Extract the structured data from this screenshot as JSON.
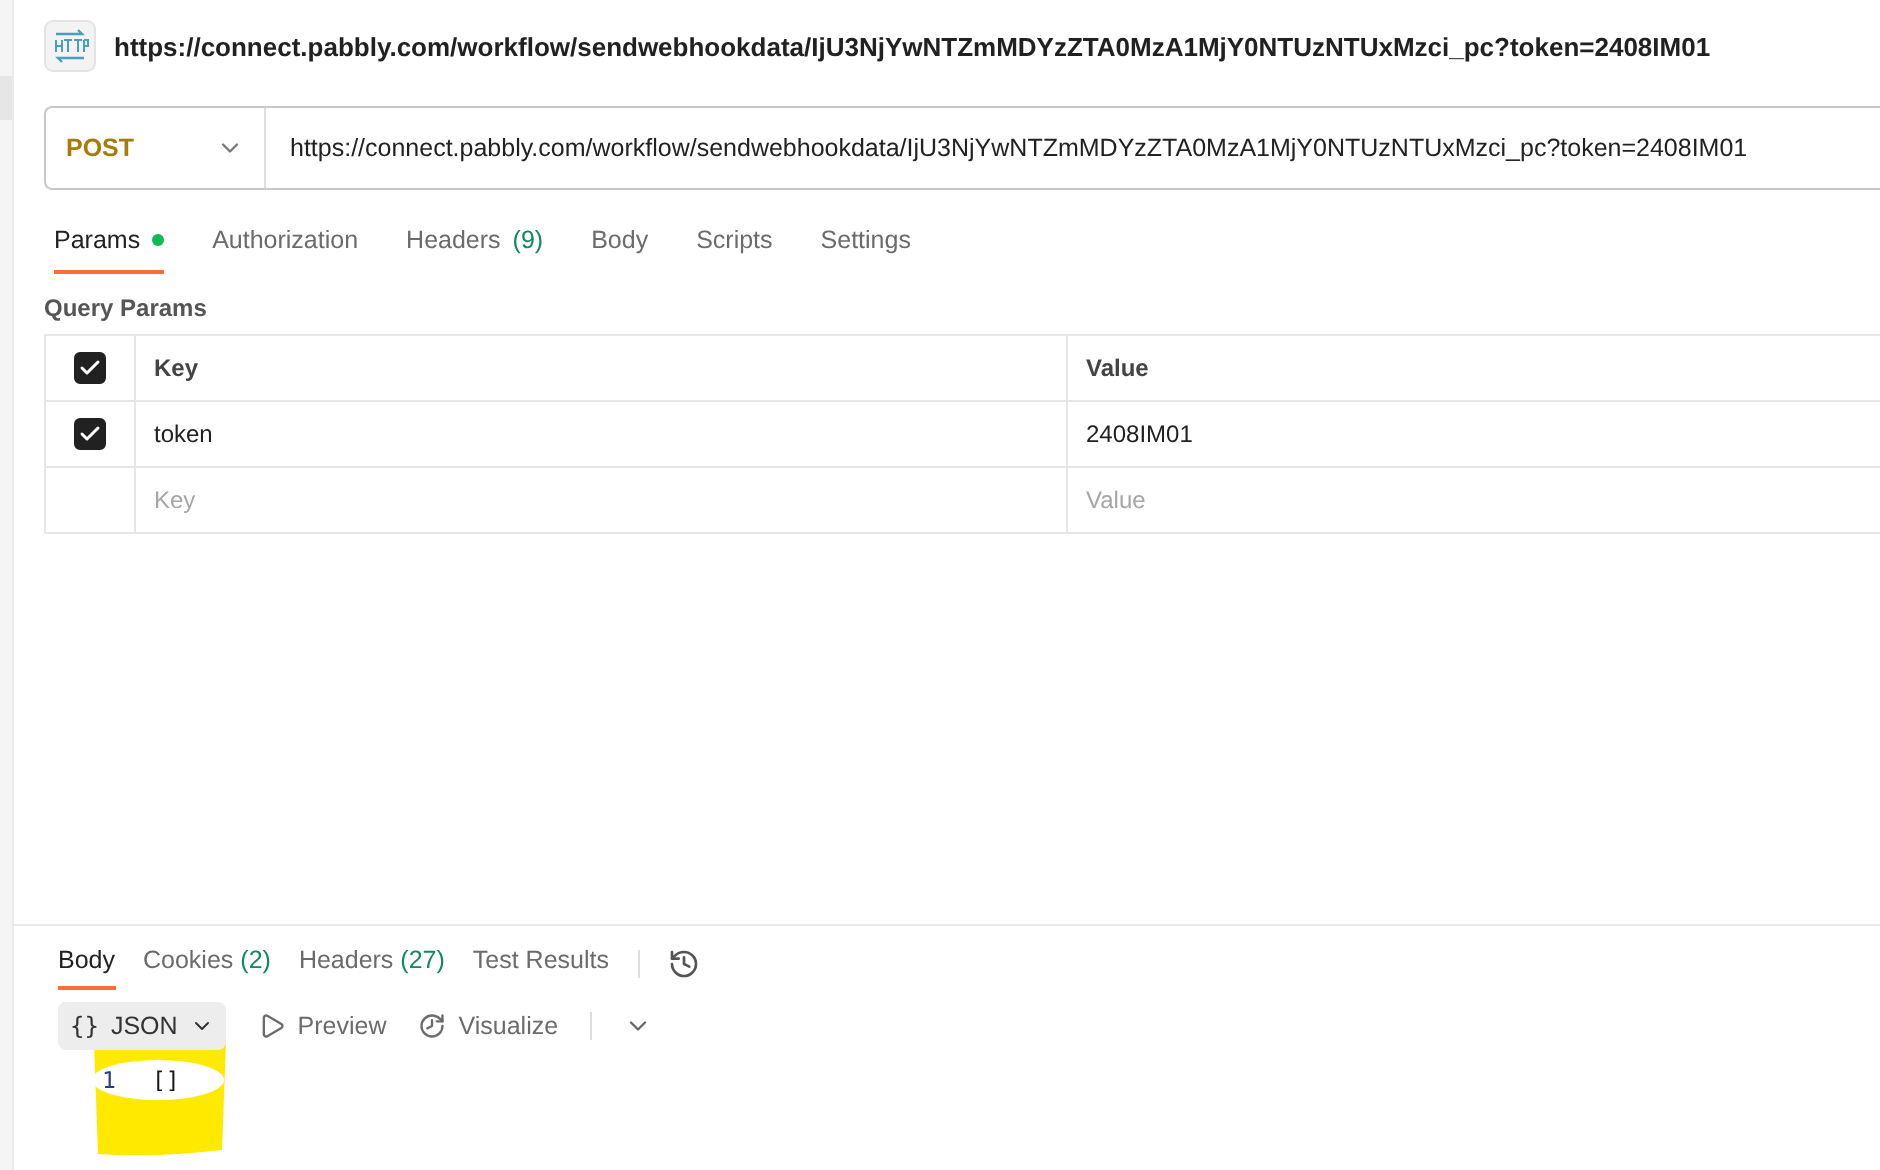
{
  "request": {
    "title": "https://connect.pabbly.com/workflow/sendwebhookdata/IjU3NjYwNTZmMDYzZTA0MzA1MjY0NTUzNTUxMzci_pc?token=2408IM01",
    "method": "POST",
    "url": "https://connect.pabbly.com/workflow/sendwebhookdata/IjU3NjYwNTZmMDYzZTA0MzA1MjY0NTUzNTUxMzci_pc?token=2408IM01"
  },
  "request_tabs": [
    {
      "label": "Params",
      "dot": true,
      "selected": true
    },
    {
      "label": "Authorization",
      "dot": false,
      "selected": false
    },
    {
      "label": "Headers",
      "count": "(9)",
      "dot": false,
      "selected": false
    },
    {
      "label": "Body",
      "dot": false,
      "selected": false
    },
    {
      "label": "Scripts",
      "dot": false,
      "selected": false
    },
    {
      "label": "Settings",
      "dot": false,
      "selected": false
    }
  ],
  "query_params": {
    "title": "Query Params",
    "columns": [
      "Key",
      "Value"
    ],
    "all_checked": true,
    "rows": [
      {
        "key": "token",
        "value": "2408IM01",
        "checked": true
      }
    ],
    "placeholder": {
      "key": "Key",
      "value": "Value"
    }
  },
  "response_tabs": [
    {
      "label": "Body",
      "selected": true
    },
    {
      "label": "Cookies",
      "count": "(2)",
      "selected": false
    },
    {
      "label": "Headers",
      "count": "(27)",
      "selected": false
    },
    {
      "label": "Test Results",
      "selected": false
    }
  ],
  "body_views": {
    "format": {
      "icon": "{}",
      "label": "JSON"
    },
    "views": [
      {
        "kind": "preview",
        "label": "Preview"
      },
      {
        "kind": "visualize",
        "label": "Visualize"
      }
    ]
  },
  "code_lines": [
    {
      "number": "1",
      "text": "[]"
    }
  ]
}
